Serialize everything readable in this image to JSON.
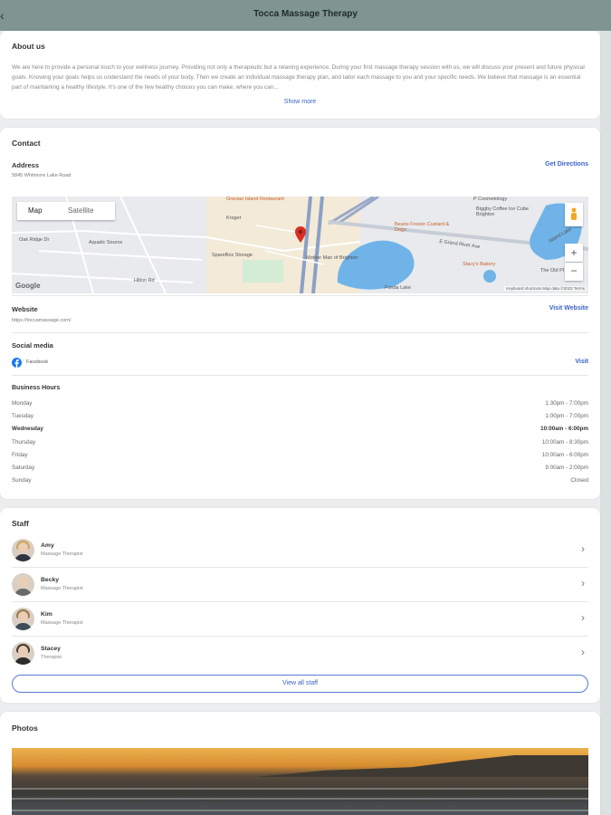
{
  "header": {
    "title": "Tocca Massage Therapy",
    "back_icon": "back-arrow-icon"
  },
  "about": {
    "heading": "About us",
    "text": "We are here to provide a personal touch to your wellness journey. Providing not only a therapeutic but a relaxing experience. During your first massage therapy session with us, we will discuss your present and future physical goals. Knowing your goals helps us understand the needs of your body. Then we create an individual massage therapy plan, and tailor each massage to you and your specific needs. We believe that massage is an essential part of maintaining a healthy lifestyle. It's one of the few healthy choices you can make, where you can...",
    "show_more": "Show more"
  },
  "contact": {
    "heading": "Contact",
    "address_label": "Address",
    "address": "5845 Whitmore Lake Road",
    "directions": "Get Directions",
    "map": {
      "tab_map": "Map",
      "tab_satellite": "Satellite",
      "zoom_in": "+",
      "zoom_out": "−",
      "attribution": "Keyboard shortcuts   Map data ©2023   Terms",
      "google": "Google",
      "labels": {
        "grecian": "Grecian Island Restaurant",
        "kroger": "Kroger",
        "sparebox": "SpareBox Storage",
        "aquatic": "Aquatic Source",
        "mother": "Mother Man of Brighton",
        "cosmetology": "P Cosmetology",
        "biggby": "Biggby Coffee Ice Cube Brighton",
        "beans": "Beans Frozen Custard & Dogs",
        "stacys": "Stacy's Bakery",
        "oldplace": "The Old Pl",
        "grandriver": "E Grand River Ave",
        "fonda": "Fonda Lake",
        "island": "Island Lake",
        "oakridge": "Oak Ridge Dr",
        "hilton": "Hilton Rd"
      }
    },
    "website_label": "Website",
    "website": "https://toccamassage.com/",
    "visit_website": "Visit Website",
    "social_label": "Social media",
    "social_name": "Facebook",
    "social_visit": "Visit",
    "hours_label": "Business Hours",
    "hours": [
      {
        "day": "Monday",
        "time": "1:30pm - 7:00pm"
      },
      {
        "day": "Tuesday",
        "time": "1:00pm - 7:00pm"
      },
      {
        "day": "Wednesday",
        "time": "10:00am - 6:00pm"
      },
      {
        "day": "Thursday",
        "time": "10:00am - 8:30pm"
      },
      {
        "day": "Friday",
        "time": "10:00am - 6:00pm"
      },
      {
        "day": "Saturday",
        "time": "9:00am - 2:00pm"
      },
      {
        "day": "Sunday",
        "time": "Closed"
      }
    ]
  },
  "staff": {
    "heading": "Staff",
    "members": [
      {
        "name": "Amy",
        "role": "Massage Therapist"
      },
      {
        "name": "Becky",
        "role": "Massage Therapist"
      },
      {
        "name": "Kim",
        "role": "Massage Therapist"
      },
      {
        "name": "Stacey",
        "role": "Therapist"
      }
    ],
    "view_all": "View all staff"
  },
  "photos": {
    "heading": "Photos"
  },
  "colors": {
    "header": "#7e9590",
    "link": "#3b63c4",
    "facebook": "#1877f2",
    "pin": "#d93025"
  }
}
